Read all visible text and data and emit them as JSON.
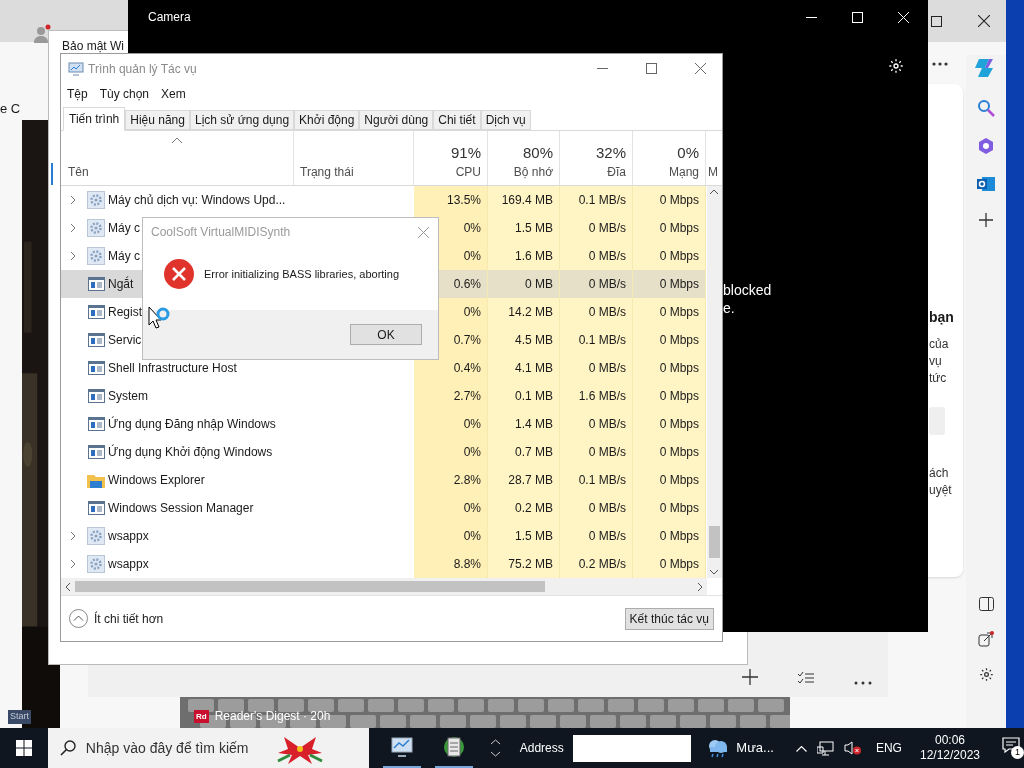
{
  "browser": {
    "partial_text": "e C",
    "card_lines": [
      {
        "text": "bạn",
        "kind": "heading"
      },
      {
        "text": "của",
        "kind": "body"
      },
      {
        "text": "vụ",
        "kind": "body"
      },
      {
        "text": "tức",
        "kind": "body"
      },
      {
        "kind": "field"
      },
      {
        "text": "ách",
        "kind": "body"
      },
      {
        "text": "uyệt",
        "kind": "body"
      }
    ]
  },
  "background_window": {
    "title": "Bảo mật Wi"
  },
  "camera": {
    "title": "Camera",
    "message_lines": [
      "blocked",
      "e."
    ]
  },
  "task_manager": {
    "title": "Trình quản lý Tác vụ",
    "menu": [
      "Tệp",
      "Tùy chọn",
      "Xem"
    ],
    "tabs": [
      {
        "label": "Tiến trình",
        "selected": true
      },
      {
        "label": "Hiệu năng",
        "selected": false
      },
      {
        "label": "Lịch sử ứng dụng",
        "selected": false
      },
      {
        "label": "Khởi động",
        "selected": false
      },
      {
        "label": "Người dùng",
        "selected": false
      },
      {
        "label": "Chi tiết",
        "selected": false
      },
      {
        "label": "Dịch vụ",
        "selected": false
      }
    ],
    "name_column": "Tên",
    "status_column": "Trạng thái",
    "columns": [
      {
        "usage": "91%",
        "label": "CPU"
      },
      {
        "usage": "80%",
        "label": "Bộ nhớ"
      },
      {
        "usage": "32%",
        "label": "Đĩa"
      },
      {
        "usage": "0%",
        "label": "Mạng"
      }
    ],
    "cut_column": "M",
    "rows": [
      {
        "name": "Máy chủ dịch vụ: Windows Upd...",
        "kind": "service",
        "expandable": true,
        "selected": false,
        "cpu": "13.5%",
        "memory": "169.4 MB",
        "disk": "0.1 MB/s",
        "network": "0 Mbps"
      },
      {
        "name": "Máy c",
        "kind": "service",
        "expandable": true,
        "selected": false,
        "cpu": "0%",
        "memory": "1.5 MB",
        "disk": "0 MB/s",
        "network": "0 Mbps"
      },
      {
        "name": "Máy c",
        "kind": "service",
        "expandable": true,
        "selected": false,
        "cpu": "0%",
        "memory": "1.6 MB",
        "disk": "0 MB/s",
        "network": "0 Mbps"
      },
      {
        "name": "Ngắt",
        "kind": "app",
        "expandable": false,
        "selected": true,
        "cpu": "0.6%",
        "memory": "0 MB",
        "disk": "0 MB/s",
        "network": "0 Mbps"
      },
      {
        "name": "Regist",
        "kind": "app",
        "expandable": false,
        "selected": false,
        "cpu": "0%",
        "memory": "14.2 MB",
        "disk": "0 MB/s",
        "network": "0 Mbps"
      },
      {
        "name": "Servic",
        "kind": "app",
        "expandable": false,
        "selected": false,
        "cpu": "0.7%",
        "memory": "4.5 MB",
        "disk": "0.1 MB/s",
        "network": "0 Mbps"
      },
      {
        "name": "Shell Infrastructure Host",
        "kind": "app",
        "expandable": false,
        "selected": false,
        "cpu": "0.4%",
        "memory": "4.1 MB",
        "disk": "0 MB/s",
        "network": "0 Mbps"
      },
      {
        "name": "System",
        "kind": "app",
        "expandable": false,
        "selected": false,
        "cpu": "2.7%",
        "memory": "0.1 MB",
        "disk": "1.6 MB/s",
        "network": "0 Mbps"
      },
      {
        "name": "Ứng dụng Đăng nhập Windows",
        "kind": "app",
        "expandable": false,
        "selected": false,
        "cpu": "0%",
        "memory": "1.4 MB",
        "disk": "0 MB/s",
        "network": "0 Mbps"
      },
      {
        "name": "Ứng dụng Khởi động Windows",
        "kind": "app",
        "expandable": false,
        "selected": false,
        "cpu": "0%",
        "memory": "0.7 MB",
        "disk": "0 MB/s",
        "network": "0 Mbps"
      },
      {
        "name": "Windows Explorer",
        "kind": "folder",
        "expandable": false,
        "selected": false,
        "cpu": "2.8%",
        "memory": "28.7 MB",
        "disk": "0.1 MB/s",
        "network": "0 Mbps"
      },
      {
        "name": "Windows Session Manager",
        "kind": "app",
        "expandable": false,
        "selected": false,
        "cpu": "0%",
        "memory": "0.2 MB",
        "disk": "0 MB/s",
        "network": "0 Mbps"
      },
      {
        "name": "wsappx",
        "kind": "service",
        "expandable": true,
        "selected": false,
        "cpu": "0%",
        "memory": "1.5 MB",
        "disk": "0 MB/s",
        "network": "0 Mbps"
      },
      {
        "name": "wsappx",
        "kind": "service",
        "expandable": true,
        "selected": false,
        "cpu": "8.8%",
        "memory": "75.2 MB",
        "disk": "0.2 MB/s",
        "network": "0 Mbps"
      }
    ],
    "fewer_details": "Ít chi tiết hơn",
    "end_task": "Kết thúc tác vụ"
  },
  "dialog": {
    "title": "CoolSoft VirtualMIDISynth",
    "message": "Error initializing BASS libraries, aborting",
    "button": "OK"
  },
  "news": {
    "logo": "Rd",
    "source": "Reader's Digest · 20h"
  },
  "taskbar": {
    "start_label": "Start",
    "search_placeholder": "Nhập vào đây để tìm kiếm",
    "address_label": "Address",
    "weather": "Mưa...",
    "language": "ENG",
    "time": "00:06",
    "date": "12/12/2023",
    "notification_count": "1"
  }
}
